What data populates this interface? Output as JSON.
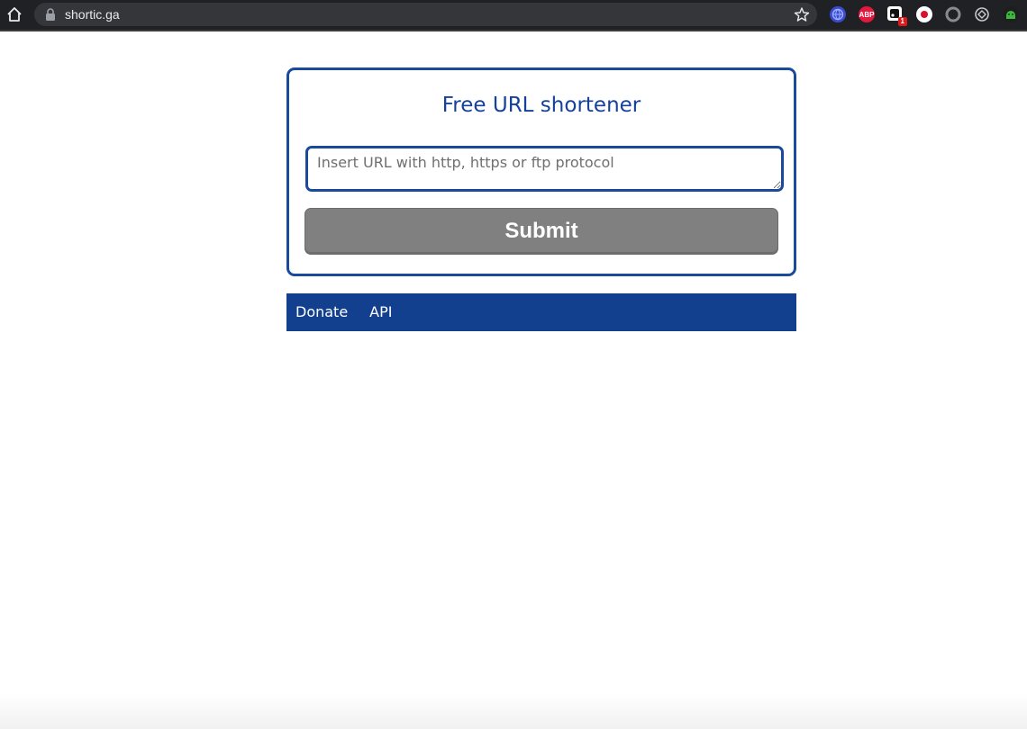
{
  "browser": {
    "url": "shortic.ga",
    "extensions": [
      {
        "icon": "globe-extension-icon",
        "color": "#3b4bd1",
        "label": ""
      },
      {
        "icon": "adblock-plus-icon",
        "color": "#e4173c",
        "label": "ABP"
      },
      {
        "icon": "badge-extension-icon",
        "color": "#ffffff",
        "label": "",
        "badge": "1"
      },
      {
        "icon": "record-extension-icon",
        "color": "#ffffff",
        "label": ""
      },
      {
        "icon": "circle-extension-icon",
        "color": "#8a8a8a",
        "label": ""
      },
      {
        "icon": "openai-extension-icon",
        "color": "#c8c8c8",
        "label": ""
      },
      {
        "icon": "android-extension-icon",
        "color": "#2a9a2a",
        "label": ""
      }
    ]
  },
  "main": {
    "title": "Free URL shortener",
    "url_input": {
      "placeholder": "Insert URL with http, https or ftp protocol",
      "value": ""
    },
    "submit_label": "Submit"
  },
  "footer": {
    "links": [
      {
        "label": "Donate"
      },
      {
        "label": "API"
      }
    ]
  },
  "colors": {
    "accent": "#1a4a9c",
    "nav_bg": "#12408f",
    "button": "#808080"
  }
}
